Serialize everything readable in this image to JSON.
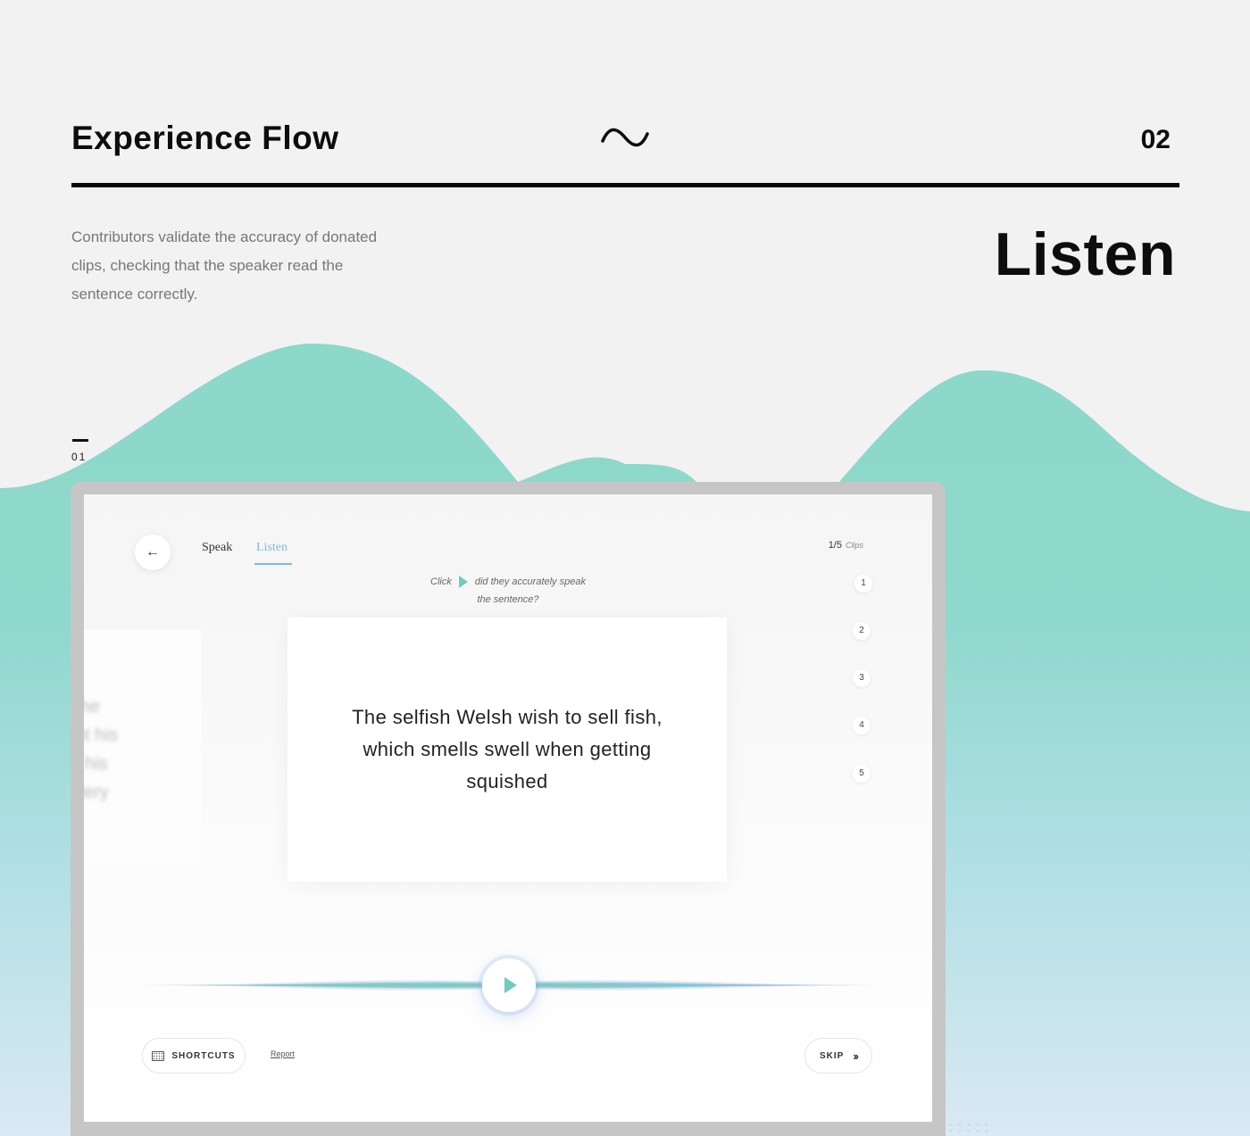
{
  "header": {
    "title": "Experience Flow",
    "page_number": "02",
    "wave_icon": "tilde-wave-icon"
  },
  "section": {
    "title": "Listen",
    "description": "Contributors validate the accuracy of donated clips, checking that the speaker read the sentence correctly.",
    "step_label": "01"
  },
  "colors": {
    "accent_teal": "#6fcbc0",
    "hill_teal": "#8cd8ca",
    "tab_blue": "#7fb8e6",
    "frame_gray": "#c6c6c6"
  },
  "app": {
    "tabs": [
      {
        "label": "Speak"
      },
      {
        "label": "Listen",
        "active": true
      }
    ],
    "progress": {
      "current": "1/5",
      "unit": "Clips"
    },
    "clips": [
      "1",
      "2",
      "3",
      "4",
      "5"
    ],
    "instruction": {
      "prefix": "Click",
      "suffix": "did they accurately speak the sentence?"
    },
    "sentence": "The selfish Welsh wish to sell fish, which smells swell when getting squished",
    "side_card_text": "the\npt his\n, his\ntlery",
    "shortcuts_label": "SHORTCUTS",
    "report_label": "Report",
    "skip_label": "SKIP"
  }
}
